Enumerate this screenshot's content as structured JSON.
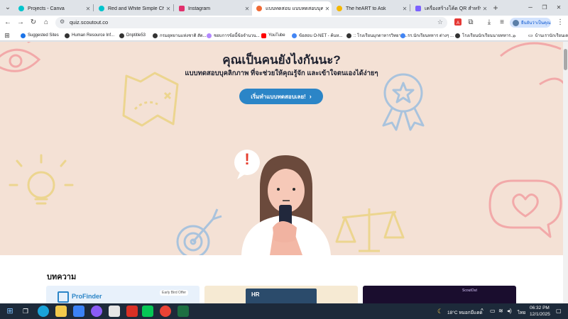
{
  "browser": {
    "tabs": [
      {
        "label": "Projects - Canva",
        "color": "#00c4cc",
        "active": false
      },
      {
        "label": "Red and White Simple Christ",
        "color": "#00c4cc",
        "active": false
      },
      {
        "label": "Instagram",
        "color": "#e1306c",
        "active": false
      },
      {
        "label": "แบบทดสอบ แบบทดสอบบุคลิกภา",
        "color": "#f06a35",
        "active": true
      },
      {
        "label": "The heART to Ask",
        "color": "#f5b800",
        "active": false
      },
      {
        "label": "เครื่องสร้างโค้ด QR สำหรับลิงก์ | ",
        "color": "#7b61ff",
        "active": false
      }
    ],
    "new_tab_symbol": "+",
    "window_controls": {
      "minimize": "–",
      "maximize": "❐",
      "close": "✕"
    },
    "url": "quiz.scoutout.co",
    "profile_label": "ยืนยันว่าเป็นคุณ",
    "bookmarks": [
      {
        "label": "Suggested Sites",
        "color": "#1a73e8"
      },
      {
        "label": "Human Resource Inf...",
        "color": "#333333"
      },
      {
        "label": "Dnptitle53",
        "color": "#333333"
      },
      {
        "label": "กรมอุทยานแห่งชาติ สัต...",
        "color": "#333333"
      },
      {
        "label": "ชอบการข้อนี้ข้อจำนวน...",
        "color": "#b388ff"
      },
      {
        "label": "YouTube",
        "color": "#ff0000"
      },
      {
        "label": "ข้อสอบ O-NET - ค้นห...",
        "color": "#4285f4"
      },
      {
        "label": ":: โรงเรียนมุกดาหารวิทยาน...",
        "color": "#333333"
      },
      {
        "label": "รร.นักเรียนทหาร ต่างๆ ...",
        "color": "#4285f4"
      },
      {
        "label": "โรงเรียนนักเรียนนายทหาร...",
        "color": "#333333"
      }
    ],
    "bookmarks_overflow": "»",
    "bookmarks_folder": "บ้านเรานักเรียนเตรี..."
  },
  "page": {
    "hero": {
      "title": "คุณเป็นคนยังไงกันนะ?",
      "subtitle": "แบบทดสอบบุคลิกภาพ ที่จะช่วยให้คุณรู้จัก และเข้าใจตนเองได้ง่ายๆ",
      "cta_label": "เริ่มทำแบบทดสอบเลย!",
      "cta_chevron": "›",
      "bubble_mark": "!"
    },
    "articles": {
      "heading": "บทความ",
      "cards": [
        {
          "brand": "ProFinder",
          "badge": "Early Bird Offer"
        },
        {
          "label": "HR"
        },
        {
          "label": "ScoutOut"
        }
      ]
    }
  },
  "taskbar": {
    "weather": "18°C  หมอกมีแดด",
    "lang": "ไทย",
    "time": "06:32 PM",
    "date": "12/1/2025"
  },
  "colors": {
    "hero_bg": "#f4e1d5",
    "cta": "#2b85c7",
    "doodle_red": "#f2a9a9",
    "doodle_yellow": "#ecd58f",
    "doodle_blue": "#a9c3dd"
  }
}
